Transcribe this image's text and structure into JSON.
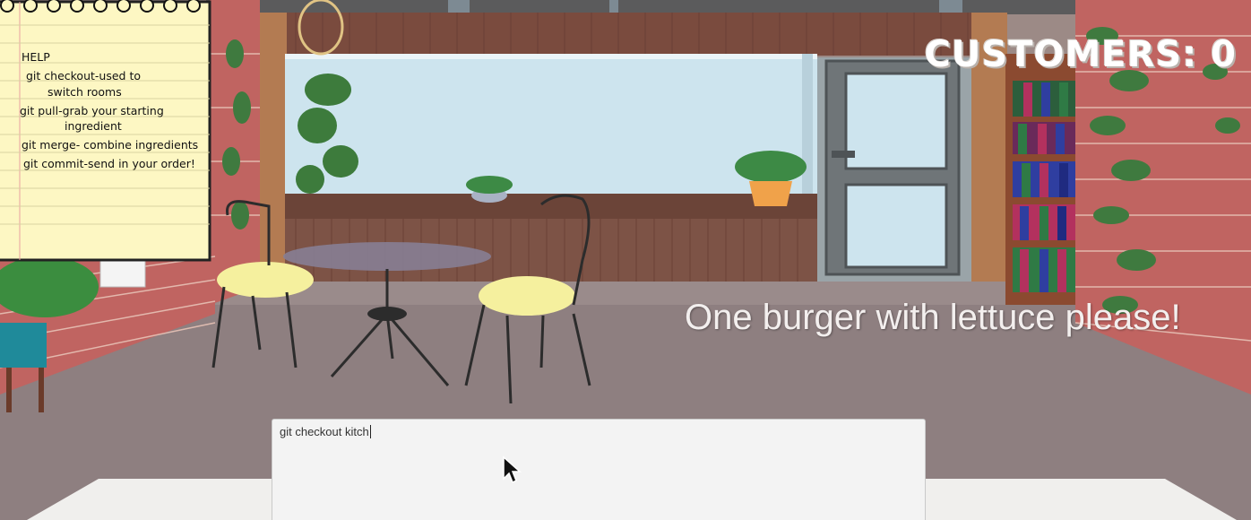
{
  "hud": {
    "customers_label": "CUSTOMERS: 0"
  },
  "order": {
    "speech": "One burger with lettuce please!"
  },
  "terminal": {
    "value": "git checkout kitch"
  },
  "help_note": {
    "title": "HELP",
    "lines": [
      "git checkout-used to",
      "switch rooms",
      "git pull-grab your starting",
      "ingredient",
      "git merge- combine ingredients",
      "git commit-send in your order!"
    ]
  },
  "colors": {
    "floor": "#8e7f80",
    "brick": "#c06461",
    "window_sky": "#cde4ee",
    "wood_trim": "#b37b52",
    "door": "#6f7578",
    "counter": "#f0efed",
    "notepad": "#fdf7c3"
  }
}
